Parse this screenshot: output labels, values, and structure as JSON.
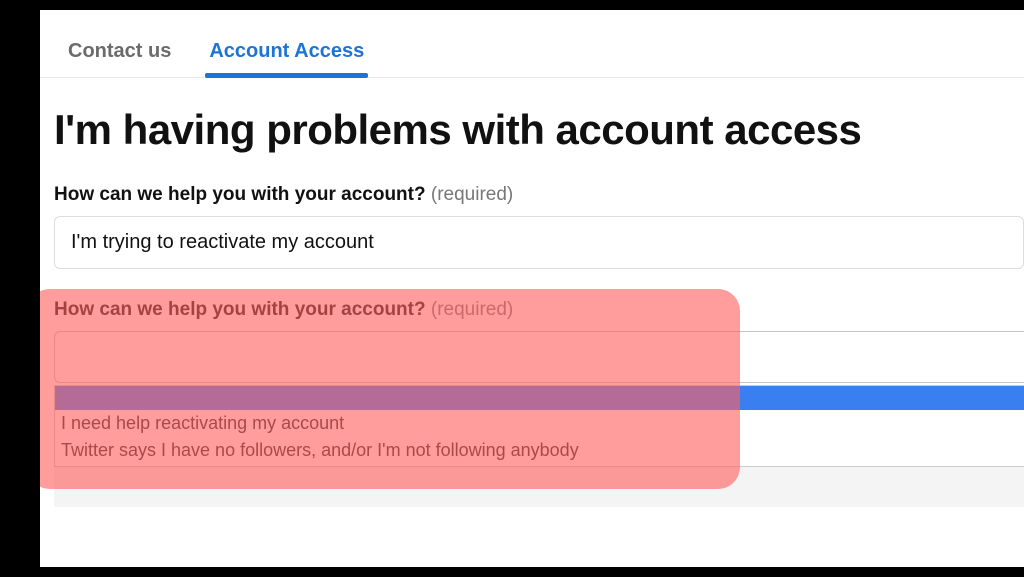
{
  "tabs": {
    "contact": "Contact us",
    "account_access": "Account Access"
  },
  "heading": "I'm having problems with account access",
  "field1": {
    "label": "How can we help you with your account?",
    "required": "(required)",
    "value": "I'm trying to reactivate my account"
  },
  "field2": {
    "label": "How can we help you with your account?",
    "required": "(required)",
    "options": {
      "blank": "",
      "opt1": "I need help reactivating my account",
      "opt2": "Twitter says I have no followers, and/or I'm not following anybody"
    }
  }
}
